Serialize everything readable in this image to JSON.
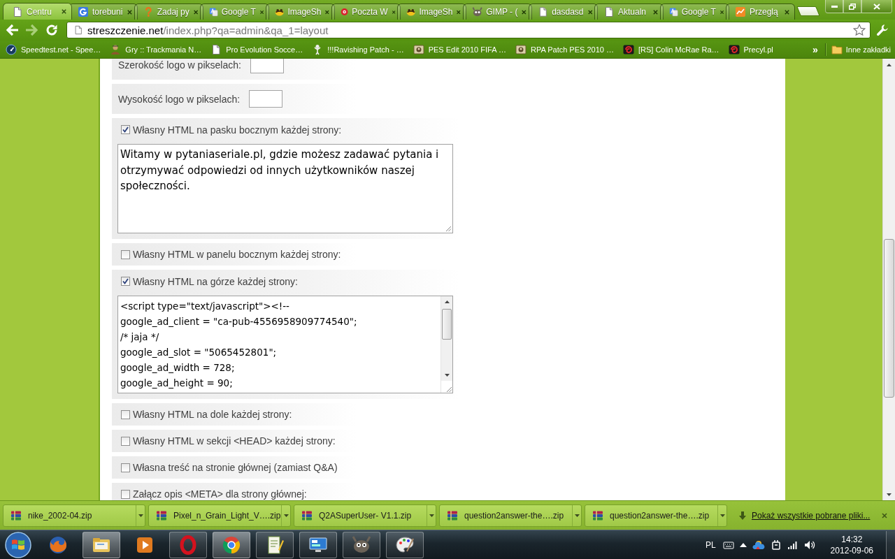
{
  "browser": {
    "tabs": [
      {
        "title": "Centru",
        "selected": true
      },
      {
        "title": "torebuni",
        "selected": false
      },
      {
        "title": "Zadaj py",
        "selected": false
      },
      {
        "title": "Google T",
        "selected": false
      },
      {
        "title": "ImageSh",
        "selected": false
      },
      {
        "title": "Poczta W",
        "selected": false
      },
      {
        "title": "ImageSh",
        "selected": false
      },
      {
        "title": "GIMP - (",
        "selected": false
      },
      {
        "title": "dasdasd",
        "selected": false
      },
      {
        "title": "Aktualn",
        "selected": false
      },
      {
        "title": "Google T",
        "selected": false
      },
      {
        "title": "Przeglą",
        "selected": false
      }
    ],
    "forward_button": {
      "disabled": true
    },
    "address": {
      "host": "streszczenie.net",
      "path": "/index.php?qa=admin&qa_1=layout"
    },
    "bookmarks": [
      {
        "label": "Speedtest.net - Spee…"
      },
      {
        "label": "Gry :: Trackmania N…"
      },
      {
        "label": "Pro Evolution Socce…"
      },
      {
        "label": "!!!Ravishing Patch - …"
      },
      {
        "label": "PES Edit 2010 FIFA …"
      },
      {
        "label": "RPA Patch PES 2010 …"
      },
      {
        "label": "[RS] Colin McRae Ra…"
      },
      {
        "label": "Precyl.pl"
      }
    ],
    "bookmarks_more": "»",
    "other_bookmarks": "Inne zakładki"
  },
  "form": {
    "rows": [
      {
        "kind": "number",
        "label": "Szerokość logo w pikselach:"
      },
      {
        "kind": "number",
        "label": "Wysokość logo w pikselach:"
      },
      {
        "kind": "checkbox",
        "label": "Własny HTML na pasku bocznym każdej strony:",
        "checked": true,
        "editor": {
          "kind": "wrapped",
          "text": "Witamy w pytaniaseriale.pl, gdzie możesz zadawać pytania i otrzymywać odpowiedzi od innych użytkowników naszej społeczności."
        }
      },
      {
        "kind": "checkbox",
        "label": "Własny HTML w panelu bocznym każdej strony:",
        "checked": false
      },
      {
        "kind": "checkbox",
        "label": "Własny HTML na górze każdej strony:",
        "checked": true,
        "editor": {
          "kind": "scrolled",
          "lines": [
            "<script type=\"text/javascript\"><!--",
            "google_ad_client = \"ca-pub-4556958909774540\";",
            "/* jaja */",
            "google_ad_slot = \"5065452801\";",
            "google_ad_width = 728;",
            "google_ad_height = 90;"
          ]
        }
      },
      {
        "kind": "checkbox",
        "label": "Własny HTML na dole każdej strony:",
        "checked": false
      },
      {
        "kind": "checkbox",
        "label": "Własny HTML w sekcji <HEAD> każdej strony:",
        "checked": false
      },
      {
        "kind": "checkbox",
        "label": "Własna treść na stronie głównej (zamiast Q&A)",
        "checked": false
      },
      {
        "kind": "checkbox",
        "label": "Załącz opis <META> dla strony głównej:",
        "checked": false
      }
    ]
  },
  "downloads": {
    "items": [
      {
        "filename": "nike_2002-04.zip"
      },
      {
        "filename": "Pixel_n_Grain_Light_V….zip"
      },
      {
        "filename": "Q2ASuperUser- V1.1.zip"
      },
      {
        "filename": "question2answer-the….zip"
      },
      {
        "filename": "question2answer-the….zip"
      }
    ],
    "show_all": "Pokaż wszystkie pobrane pliki..."
  },
  "taskbar": {
    "apps": [
      {
        "running": false,
        "highlighted": false
      },
      {
        "running": true,
        "highlighted": true
      },
      {
        "running": false,
        "highlighted": false
      },
      {
        "running": true,
        "highlighted": false
      },
      {
        "running": true,
        "highlighted": true
      },
      {
        "running": true,
        "highlighted": false
      },
      {
        "running": true,
        "highlighted": false
      },
      {
        "running": true,
        "highlighted": false
      },
      {
        "running": true,
        "highlighted": false
      }
    ],
    "language": "PL",
    "time": "14:32",
    "date": "2012-09-06"
  }
}
